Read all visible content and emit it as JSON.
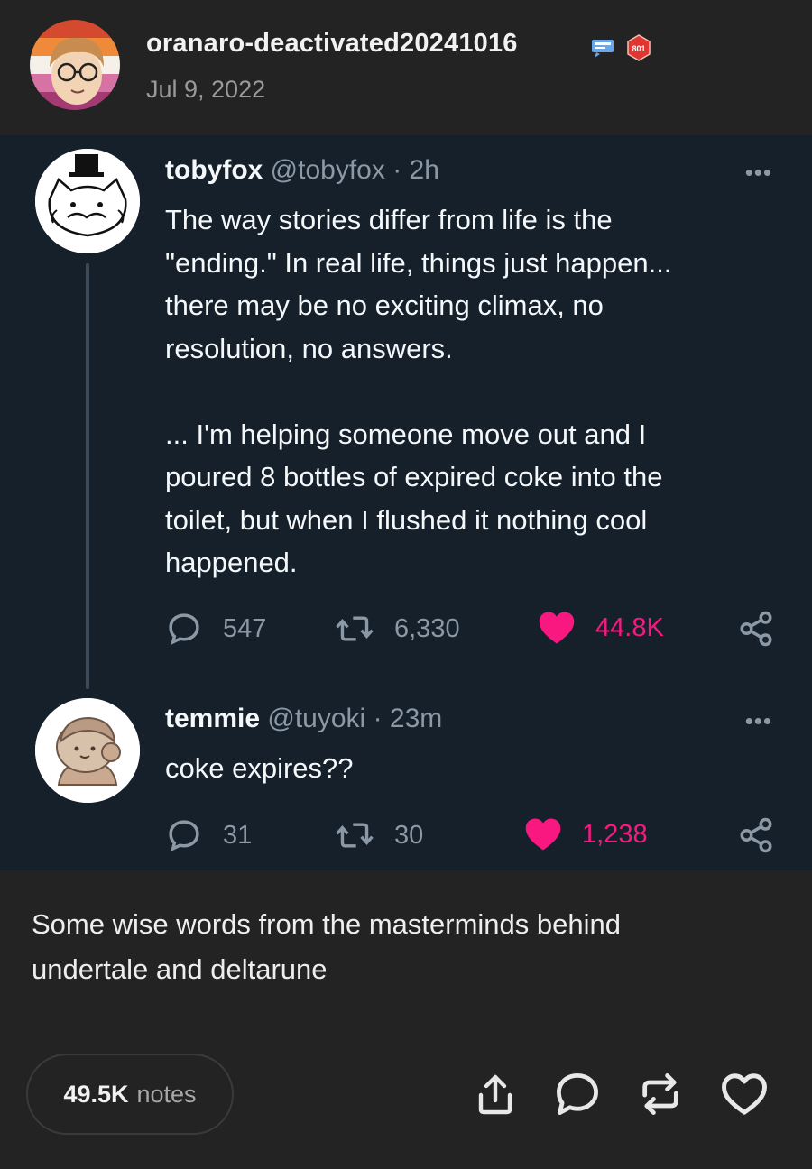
{
  "post": {
    "blog_name": "oranaro-deactivated20241016",
    "date": "Jul 9, 2022",
    "badge_number": "801",
    "caption_line1": "Some wise words from the masterminds behind",
    "caption_line2": "undertale and deltarune",
    "notes_count": "49.5K",
    "notes_label": "notes"
  },
  "tweets": [
    {
      "name": "tobyfox",
      "handle": "@tobyfox",
      "time": "· 2h",
      "more": "•••",
      "lines": [
        "The way stories differ from life is the",
        "\"ending.\" In real life, things just happen...",
        "there may be no exciting climax, no",
        "resolution, no answers.",
        "",
        "... I'm helping someone move out and I",
        "poured 8 bottles of expired coke into the",
        "toilet, but when I flushed it nothing cool",
        "happened."
      ],
      "replies": "547",
      "retweets": "6,330",
      "likes": "44.8K"
    },
    {
      "name": "temmie",
      "handle": "@tuyoki",
      "time": "· 23m",
      "more": "•••",
      "lines": [
        "coke expires??"
      ],
      "replies": "31",
      "retweets": "30",
      "likes": "1,238"
    }
  ],
  "colors": {
    "tweet_bg": "#15202b",
    "tumblr_bg": "#232323",
    "like_pink": "#f91880",
    "muted": "#8b98a5"
  },
  "icons": [
    "reply-icon",
    "retweet-icon",
    "heart-icon",
    "share-icon",
    "upload-icon",
    "comment-icon",
    "reblog-icon",
    "like-icon"
  ]
}
